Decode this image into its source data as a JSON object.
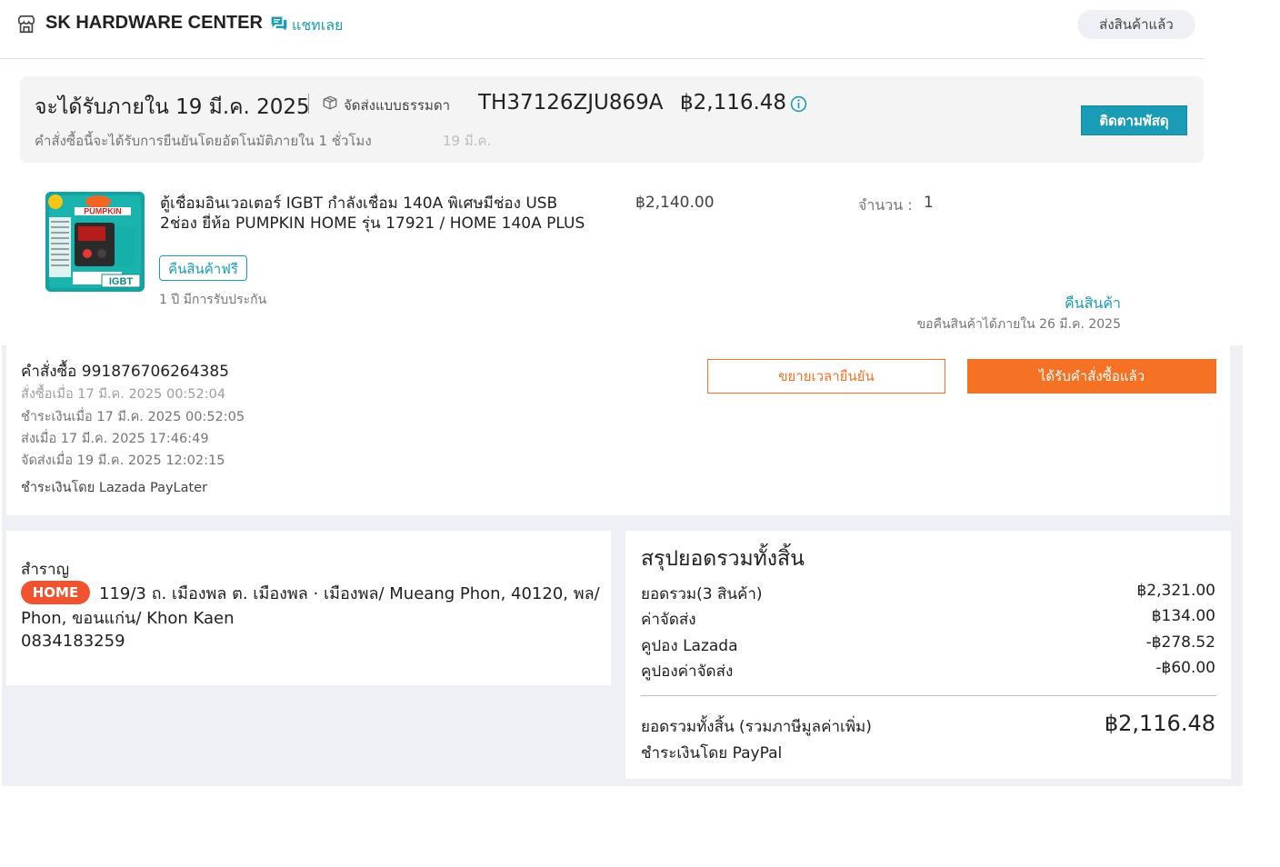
{
  "shop": {
    "name": "SK HARDWARE CENTER",
    "chat_label": "แชทเลย",
    "status": "ส่งสินค้าแล้ว"
  },
  "delivery": {
    "title": "จะได้รับภายใน 19 มี.ค. 2025",
    "method": "จัดส่งแบบธรรมดา",
    "tracking_no": "TH37126ZJU869A",
    "amount": "฿2,116.48",
    "auto_confirm": "คำสั่งซื้อนี้จะได้รับการยืนยันโดยอัตโนมัติภายใน 1 ชั่วโมง",
    "auto_confirm_date": "19 มี.ค.",
    "track_button": "ติดตามพัสดุ"
  },
  "product": {
    "title_line1": "ตู้เชื่อมอินเวอเตอร์ IGBT กำลังเชื่อม 140A พิเศษมีช่อง USB",
    "title_line2": "2ช่อง ยี่ห้อ PUMPKIN HOME รุ่น 17921 / HOME 140A PLUS",
    "image_brand": "PUMPKIN",
    "image_badge": "IGBT",
    "free_return": "คืนสินค้าฟรี",
    "warranty": "1 ปี มีการรับประกัน",
    "price": "฿2,140.00",
    "qty_label": "จำนวน :",
    "qty_value": "1",
    "return_link": "คืนสินค้า",
    "return_deadline": "ขอคืนสินค้าได้ภายใน 26 มี.ค. 2025"
  },
  "order": {
    "number": "คำสั่งซื้อ 991876706264385",
    "ordered_at": "สั่งซื้อเมื่อ 17 มี.ค. 2025 00:52:04",
    "paid_at": "ชำระเงินเมื่อ 17 มี.ค. 2025 00:52:05",
    "shipped_at": "ส่งเมื่อ 17 มี.ค. 2025 17:46:49",
    "delivered_at": "จัดส่งเมื่อ 19 มี.ค. 2025 12:02:15",
    "paid_by": "ชำระเงินโดย Lazada PayLater",
    "extend_button": "ขยายเวลายืนยัน",
    "received_button": "ได้รับคำสั่งซื้อแล้ว"
  },
  "address": {
    "name": "สำราญ",
    "badge": "HOME",
    "text": "119/3 ถ. เมืองพล ต. เมืองพล · เมืองพล/ Mueang Phon, 40120, พล/ Phon, ขอนแก่น/ Khon Kaen",
    "phone": "0834183259"
  },
  "summary": {
    "title": "สรุปยอดรวมทั้งสิ้น",
    "rows": [
      {
        "label": "ยอดรวม(3 สินค้า)",
        "value": "฿2,321.00"
      },
      {
        "label": "ค่าจัดส่ง",
        "value": "฿134.00"
      },
      {
        "label": "คูปอง Lazada",
        "value": "-฿278.52"
      },
      {
        "label": "คูปองค่าจัดส่ง",
        "value": "-฿60.00"
      }
    ],
    "total_label": "ยอดรวมทั้งสิ้น (รวมภาษีมูลค่าเพิ่ม)",
    "total_value": "฿2,116.48",
    "paid_by": "ชำระเงินโดย PayPal"
  },
  "colors": {
    "accent": "#1a9cb7",
    "orange": "#f57224",
    "home_badge": "#f0532d",
    "gray_bg": "#eff0f5"
  },
  "icons": [
    "store-icon",
    "chat-icon",
    "shipping-box-icon",
    "info-icon"
  ]
}
